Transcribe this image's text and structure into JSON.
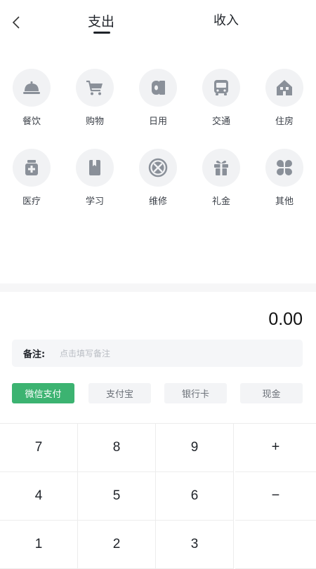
{
  "header": {
    "expense_tab": "支出",
    "income_tab": "收入"
  },
  "categories": [
    {
      "label": "餐饮",
      "icon": "dining-cloche-icon"
    },
    {
      "label": "购物",
      "icon": "shopping-cart-icon"
    },
    {
      "label": "日用",
      "icon": "tissue-roll-icon"
    },
    {
      "label": "交通",
      "icon": "bus-icon"
    },
    {
      "label": "住房",
      "icon": "house-icon"
    },
    {
      "label": "医疗",
      "icon": "medicine-bottle-icon"
    },
    {
      "label": "学习",
      "icon": "book-icon"
    },
    {
      "label": "维修",
      "icon": "repair-tools-icon"
    },
    {
      "label": "礼金",
      "icon": "gift-icon"
    },
    {
      "label": "其他",
      "icon": "clover-icon"
    }
  ],
  "amount": "0.00",
  "remark": {
    "label": "备注:",
    "placeholder": "点击填写备注"
  },
  "payment_methods": [
    "微信支付",
    "支付宝",
    "银行卡",
    "现金"
  ],
  "keypad": {
    "keys": [
      "7",
      "8",
      "9",
      "+",
      "4",
      "5",
      "6",
      "−",
      "1",
      "2",
      "3",
      ""
    ]
  },
  "colors": {
    "accent": "#3cb371",
    "icon_gray": "#8a9099",
    "icon_bg": "#f1f2f4"
  }
}
